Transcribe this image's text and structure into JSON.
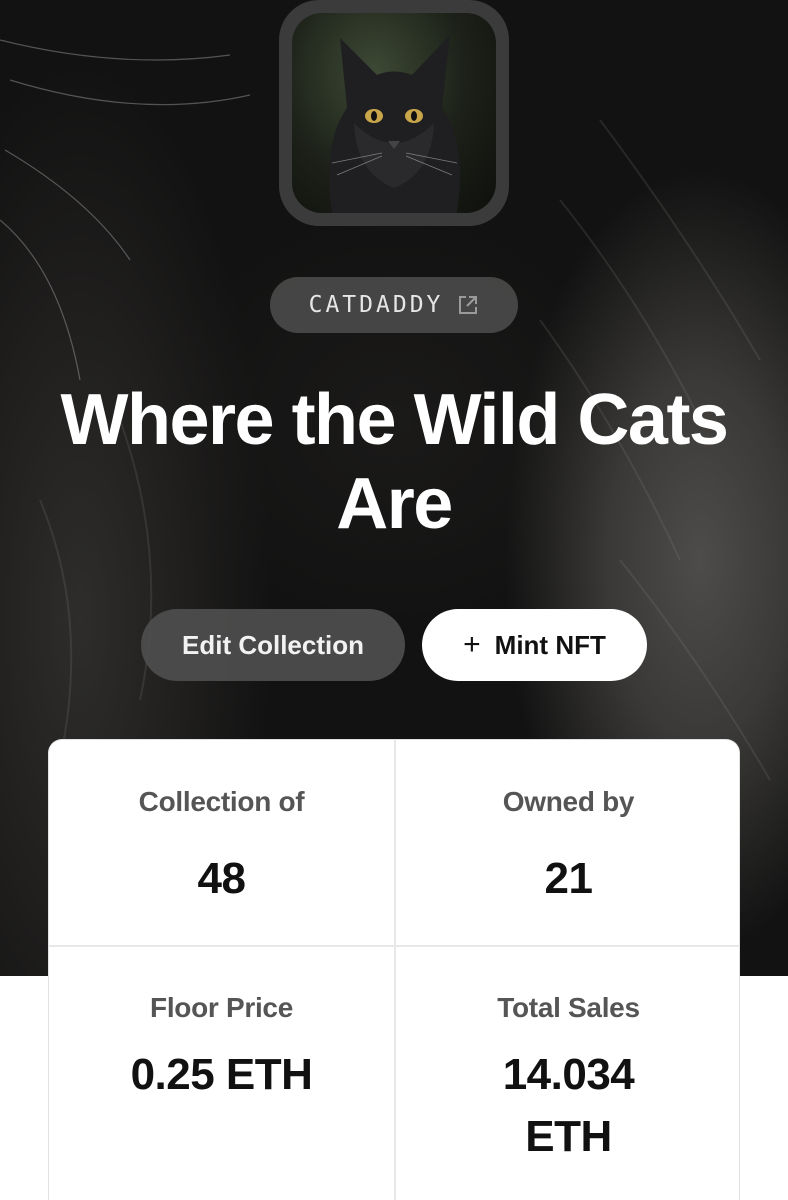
{
  "collection": {
    "creator": "CATDADDY",
    "title": "Where the Wild Cats Are"
  },
  "icons": {
    "external_link": "external-link-icon",
    "plus": "plus-icon"
  },
  "actions": {
    "edit_label": "Edit Collection",
    "mint_label": "Mint NFT",
    "mint_icon": "+"
  },
  "stats": [
    {
      "label": "Collection of",
      "value": "48"
    },
    {
      "label": "Owned by",
      "value": "21"
    },
    {
      "label": "Floor Price",
      "value": "0.25 ETH"
    },
    {
      "label": "Total Sales",
      "value": "14.034 ETH"
    }
  ],
  "colors": {
    "hero_dark": "#141414",
    "pill": "#555555",
    "mint_button": "#ffffff",
    "edit_button": "#4e4e4e",
    "stat_label": "#555555",
    "stat_value": "#111111"
  }
}
